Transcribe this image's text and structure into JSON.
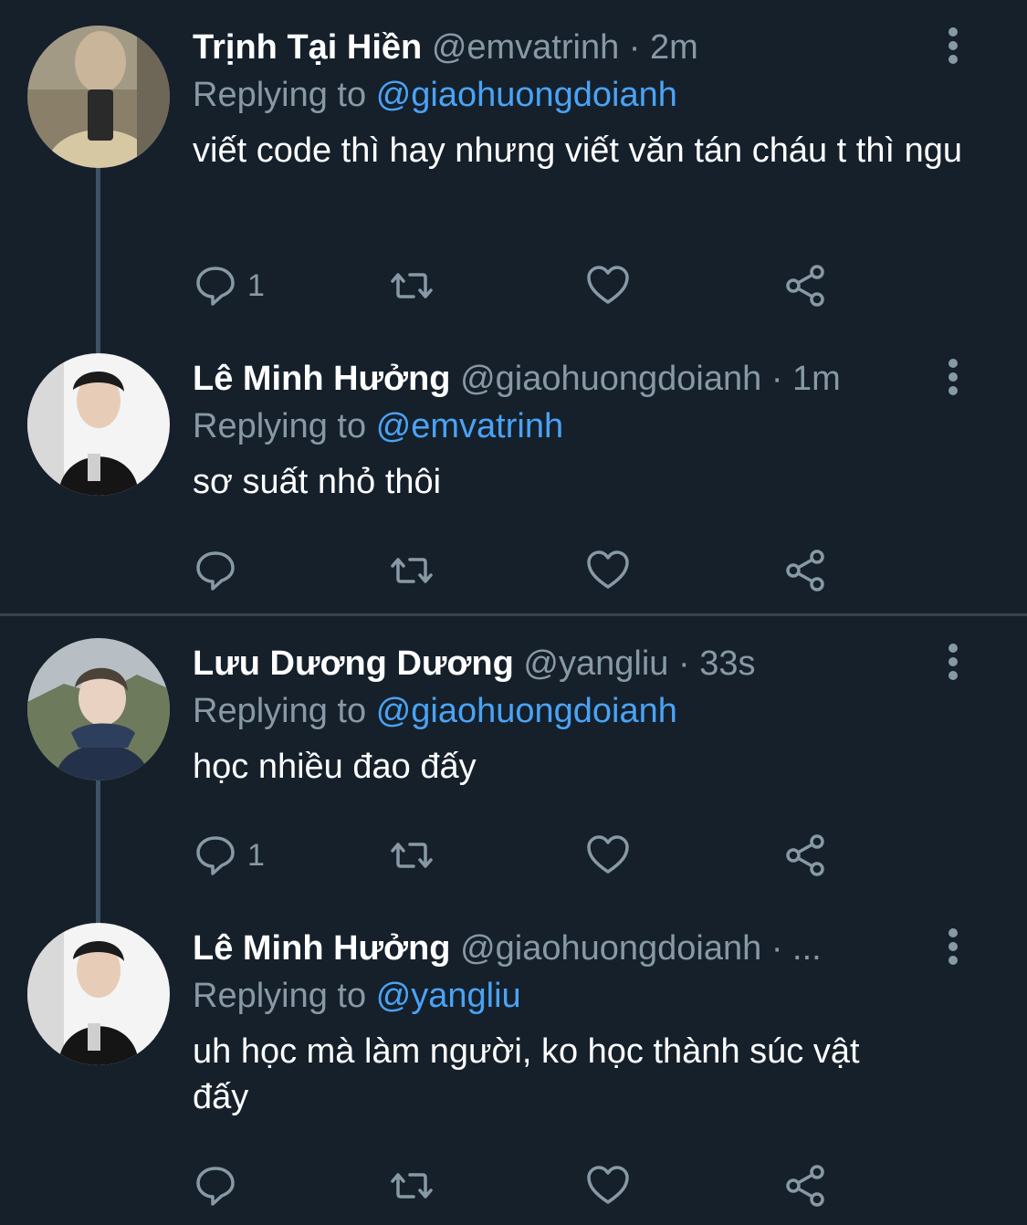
{
  "tweets": [
    {
      "name": "Trịnh Tại Hiền",
      "handle": "@emvatrinh",
      "separator": "·",
      "time": "2m",
      "replying_label": "Replying to",
      "replying_to": "@giaohuongdoianh",
      "text": "viết code thì hay nhưng viết văn tán cháu t thì ngu",
      "reply_count": "1"
    },
    {
      "name": "Lê Minh Hưởng",
      "handle": "@giaohuongdoianh",
      "separator": "·",
      "time": "1m",
      "replying_label": "Replying to",
      "replying_to": "@emvatrinh",
      "text": "sơ suất nhỏ thôi",
      "reply_count": ""
    },
    {
      "name": "Lưu Dương Dương",
      "handle": "@yangliu",
      "separator": "·",
      "time": "33s",
      "replying_label": "Replying to",
      "replying_to": "@giaohuongdoianh",
      "text": "học nhiều đao đấy",
      "reply_count": "1"
    },
    {
      "name": "Lê Minh Hưởng",
      "handle": "@giaohuongdoianh",
      "separator": "·",
      "time": "...",
      "replying_label": "Replying to",
      "replying_to": "@yangliu",
      "text": "uh học mà làm người, ko học thành súc vật đấy",
      "reply_count": ""
    }
  ],
  "icons": {
    "reply": "reply-icon",
    "retweet": "retweet-icon",
    "like": "heart-icon",
    "share": "share-icon",
    "more": "more-vertical-icon"
  },
  "colors": {
    "background": "#15202b",
    "text": "#ffffff",
    "muted": "#8899a6",
    "mention": "#4aa3f5",
    "thread_line": "#3d5466",
    "divider": "#38444d"
  }
}
